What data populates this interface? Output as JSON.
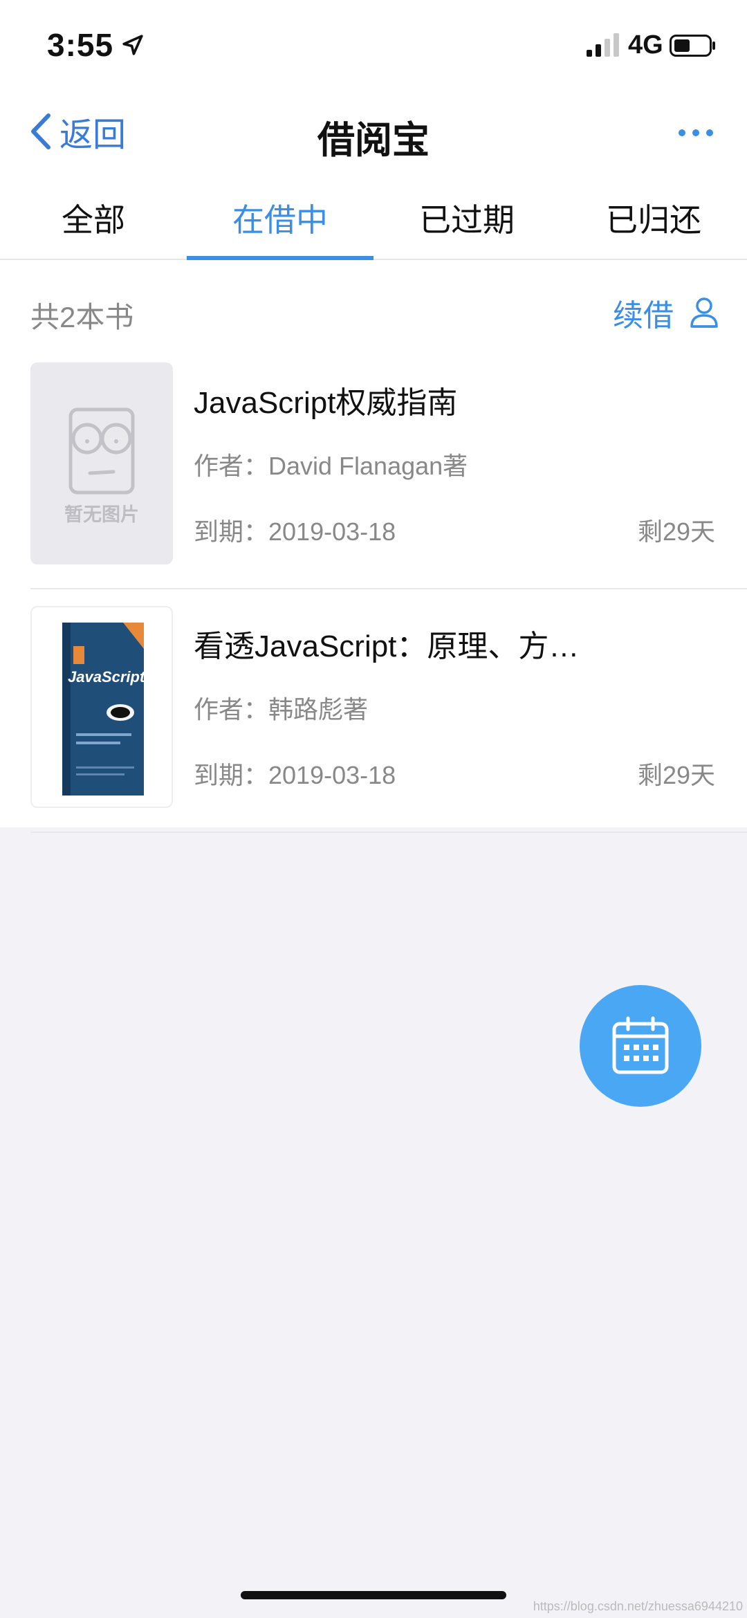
{
  "status_bar": {
    "time": "3:55",
    "network": "4G"
  },
  "nav": {
    "back_label": "返回",
    "title": "借阅宝"
  },
  "tabs": [
    {
      "label": "全部",
      "active": false
    },
    {
      "label": "在借中",
      "active": true
    },
    {
      "label": "已过期",
      "active": false
    },
    {
      "label": "已归还",
      "active": false
    }
  ],
  "summary": {
    "count_text": "共2本书",
    "renew_label": "续借"
  },
  "books": [
    {
      "title": "JavaScript权威指南",
      "author": "作者：David Flanagan著",
      "due": "到期：2019-03-18",
      "remaining": "剩29天",
      "cover_placeholder_text": "暂无图片"
    },
    {
      "title": "看透JavaScript：原理、方…",
      "author": "作者：韩路彪著",
      "due": "到期：2019-03-18",
      "remaining": "剩29天",
      "cover_text": "JavaScript"
    }
  ],
  "watermark": "https://blog.csdn.net/zhuessa6944210",
  "colors": {
    "accent": "#3a8ee6",
    "fab": "#4aa7f3",
    "background": "#f2f2f7"
  },
  "icons": [
    "location-arrow-icon",
    "signal-icon",
    "battery-icon",
    "back-chevron-icon",
    "more-icon",
    "user-icon",
    "calendar-icon"
  ]
}
